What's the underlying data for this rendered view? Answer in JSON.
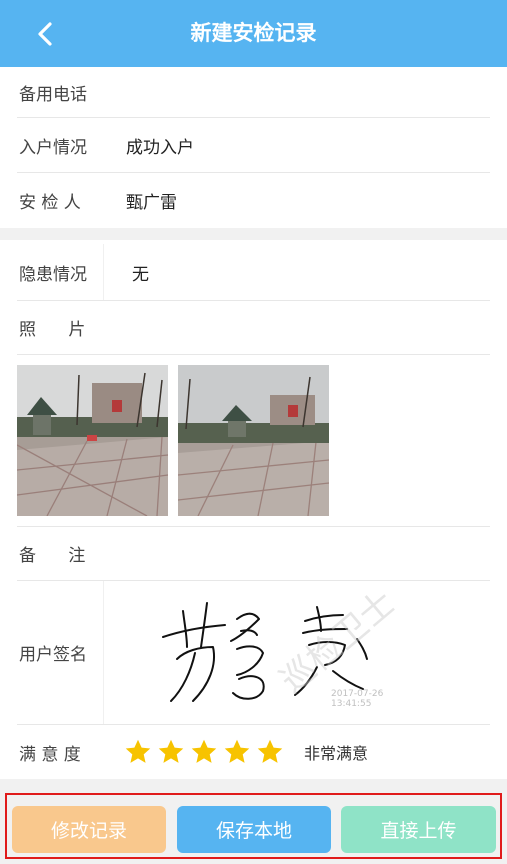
{
  "header": {
    "title": "新建安检记录",
    "back_icon": "chevron-left-icon",
    "color": "#56b4f1"
  },
  "info": {
    "backup_phone": {
      "label": "备用电话",
      "value": ""
    },
    "entry": {
      "label": "入户情况",
      "value": "成功入户"
    },
    "inspector": {
      "label": "安 检 人",
      "value": "甄广雷"
    }
  },
  "details": {
    "hazard": {
      "label": "隐患情况",
      "value": "无"
    },
    "photos": {
      "label": "照      片",
      "items": [
        "photo-1",
        "photo-2"
      ]
    },
    "remark": {
      "label": "备      注",
      "value": ""
    },
    "signature": {
      "label": "用户签名",
      "timestamp": "2017-07-26 13:41:55"
    },
    "satisfaction": {
      "label": "满 意 度",
      "rating": 5,
      "max": 5,
      "text": "非常满意"
    }
  },
  "actions": {
    "modify": {
      "label": "修改记录",
      "color": "#f9c88d"
    },
    "save": {
      "label": "保存本地",
      "color": "#56b4f1"
    },
    "upload": {
      "label": "直接上传",
      "color": "#8fe3c7"
    }
  }
}
